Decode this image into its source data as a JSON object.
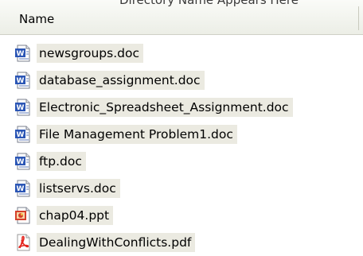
{
  "header": {
    "top_strip_text": "Directory Name Appears Here",
    "name_column_label": "Name"
  },
  "files": [
    {
      "name": "newsgroups.doc",
      "icon": "word-doc-icon"
    },
    {
      "name": "database_assignment.doc",
      "icon": "word-doc-icon"
    },
    {
      "name": "Electronic_Spreadsheet_Assignment.doc",
      "icon": "word-doc-icon"
    },
    {
      "name": "File Management Problem1.doc",
      "icon": "word-doc-icon"
    },
    {
      "name": "ftp.doc",
      "icon": "word-doc-icon"
    },
    {
      "name": "listservs.doc",
      "icon": "word-doc-icon"
    },
    {
      "name": "chap04.ppt",
      "icon": "powerpoint-ppt-icon"
    },
    {
      "name": "DealingWithConflicts.pdf",
      "icon": "pdf-icon"
    }
  ],
  "colors": {
    "selection_bg": "#ebeae1",
    "word_blue": "#2b56b5",
    "ppt_red": "#d5402b",
    "pdf_red": "#e3231c"
  }
}
